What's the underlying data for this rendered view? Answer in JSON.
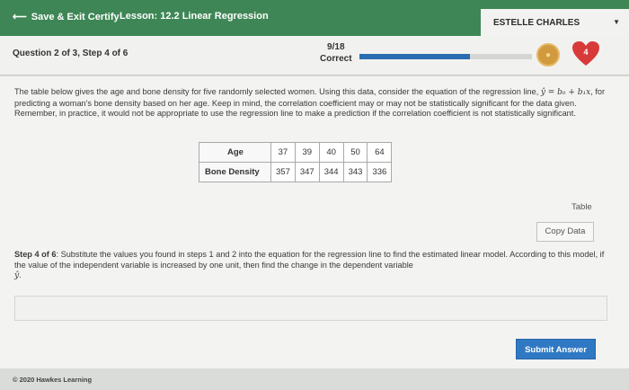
{
  "header": {
    "save_label": "Save & Exit Certify",
    "lesson_label": "Lesson: 12.2 Linear Regression",
    "user_name": "ESTELLE CHARLES"
  },
  "question_bar": {
    "question_label": "Question 2 of 3, Step 4 of 6",
    "score": "9/18",
    "score_status": "Correct",
    "progress_fraction": 0.64,
    "lives": "4"
  },
  "problem": {
    "intro_before_eq": "The table below gives the age and bone density for five randomly selected women. Using this data, consider the equation of the regression line, ",
    "equation": "ŷ = b₀ + b₁x",
    "intro_after_eq": ", for predicting a woman's bone density based on her age. Keep in mind, the correlation coefficient may or may not be statistically significant for the data given. Remember, in practice, it would not be appropriate to use the regression line to make a prediction if the correlation coefficient is not statistically significant.",
    "table": {
      "row1_label": "Age",
      "row1_values": [
        "37",
        "39",
        "40",
        "50",
        "64"
      ],
      "row2_label": "Bone Density",
      "row2_values": [
        "357",
        "347",
        "344",
        "343",
        "336"
      ]
    },
    "table_link": "Table",
    "copy_data_label": "Copy Data",
    "step_label": "Step 4 of 6",
    "step_text": ":  Substitute the values you found in steps 1 and 2 into the equation for the regression line to find the estimated linear model. According to this model, if the value of the independent variable is increased by one unit, then find the change in the dependent variable ",
    "step_var": "ŷ",
    "step_end": "."
  },
  "answer": {
    "value": ""
  },
  "submit_label": "Submit Answer",
  "footer": {
    "copyright": "© 2020 Hawkes Learning"
  },
  "colors": {
    "topbar": "#3f8656",
    "accent": "#2f79c4",
    "heart": "#d83a3a",
    "coin": "#d19a3f"
  },
  "icons": {
    "back": "arrow-left-icon",
    "caret": "chevron-down-icon",
    "coin": "coin-icon",
    "heart": "heart-icon"
  }
}
